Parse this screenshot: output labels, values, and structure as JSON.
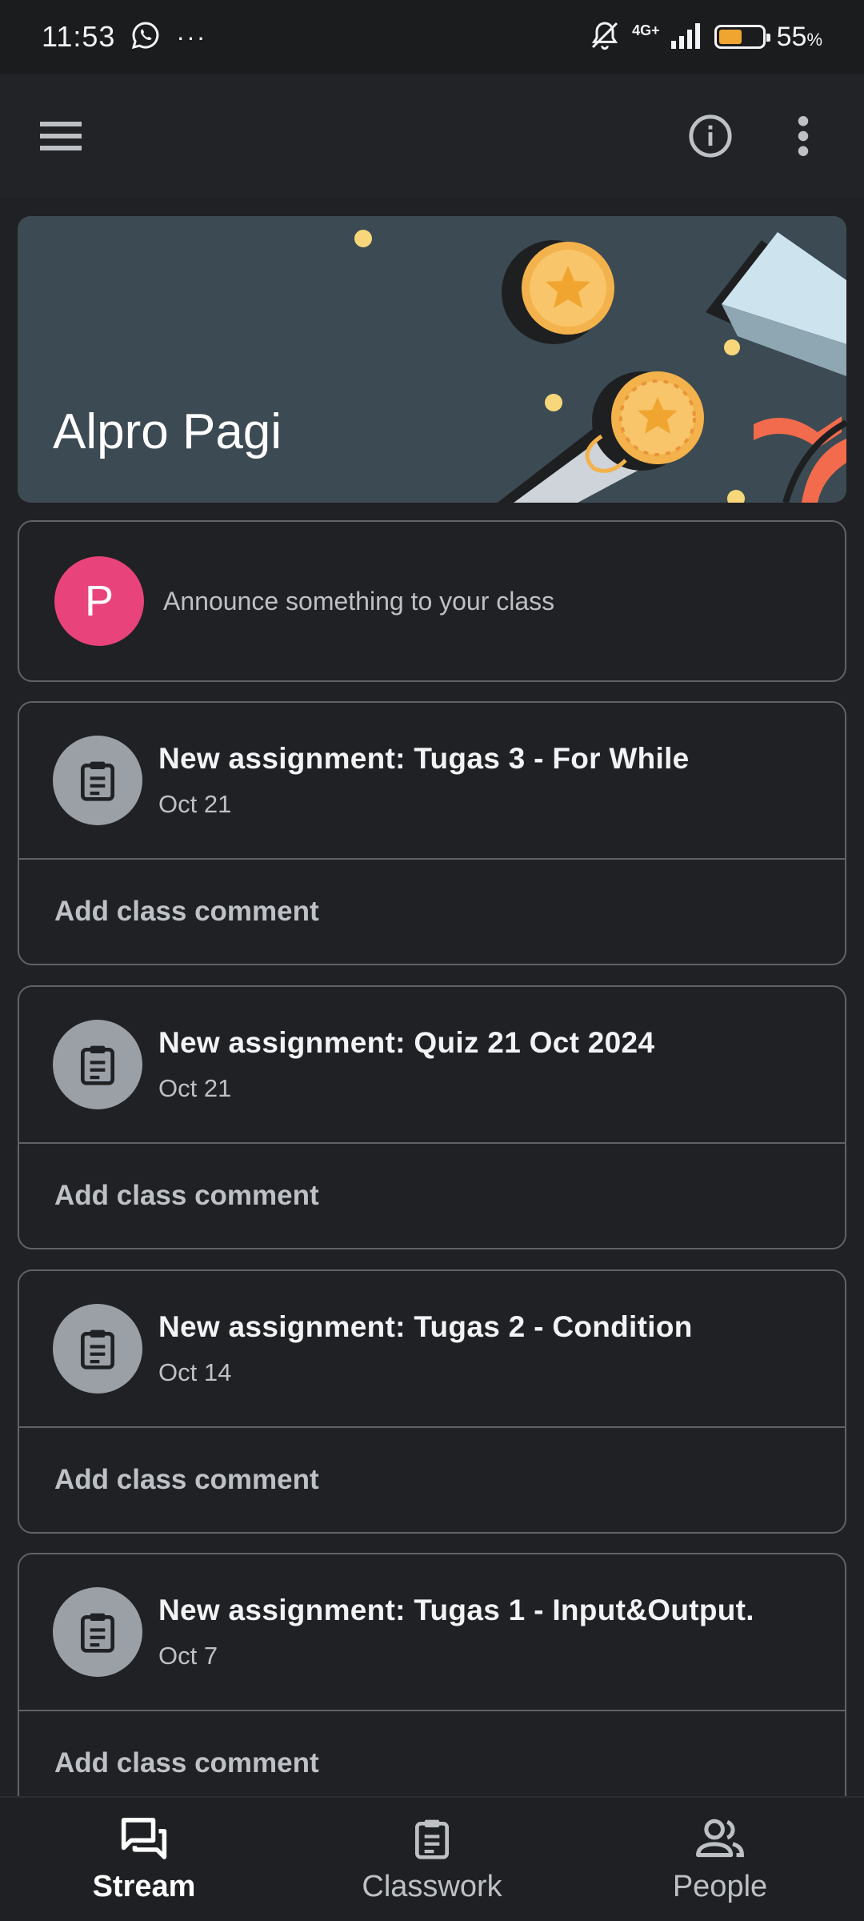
{
  "status_bar": {
    "time": "11:53",
    "dots": "···",
    "network": "4G+",
    "battery_percent": "55",
    "battery_unit": "%",
    "battery_level": 0.55,
    "battery_color": "#f0a531"
  },
  "app_bar": {
    "menu_icon": "hamburger-menu-icon",
    "info_icon": "info-icon",
    "more_icon": "more-vert-icon"
  },
  "banner": {
    "title": "Alpro Pagi",
    "background_color": "#3c4a53"
  },
  "announce": {
    "avatar_letter": "P",
    "avatar_color": "#e8437a",
    "placeholder": "Announce something to your class"
  },
  "posts": [
    {
      "title": "New assignment: Tugas 3 - For While",
      "date": "Oct 21",
      "comment": "Add class comment"
    },
    {
      "title": "New assignment: Quiz 21 Oct 2024",
      "date": "Oct 21",
      "comment": "Add class comment"
    },
    {
      "title": "New assignment: Tugas 2 - Condition",
      "date": "Oct 14",
      "comment": "Add class comment"
    },
    {
      "title": "New assignment: Tugas 1 - Input&Output.",
      "date": "Oct 7",
      "comment": "Add class comment"
    }
  ],
  "bottom_nav": {
    "items": [
      {
        "label": "Stream",
        "icon": "stream-icon",
        "active": true
      },
      {
        "label": "Classwork",
        "icon": "clipboard-icon",
        "active": false
      },
      {
        "label": "People",
        "icon": "people-icon",
        "active": false
      }
    ]
  }
}
